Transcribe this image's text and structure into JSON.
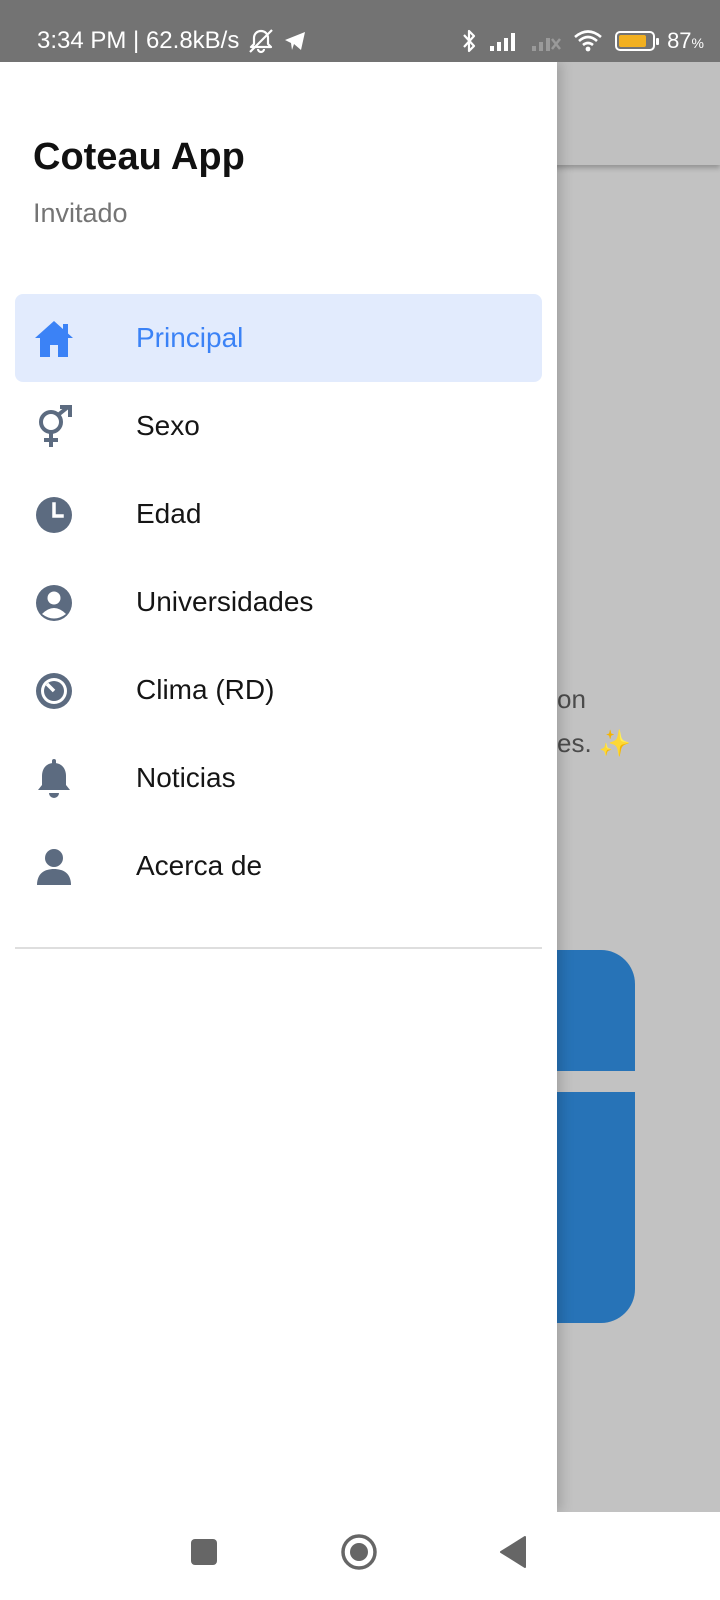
{
  "status_bar": {
    "time_speed": "3:34 PM | 62.8kB/s",
    "battery_percent": "87",
    "battery_unit": "%",
    "battery_level": 0.87,
    "battery_color": "#f2b020",
    "icons": [
      "bell-off-icon",
      "telegram-icon",
      "bluetooth-icon",
      "signal-icon",
      "signal-off-icon",
      "wifi-icon",
      "battery-icon"
    ]
  },
  "drawer": {
    "title": "Coteau App",
    "subtitle": "Invitado",
    "items": [
      {
        "label": "Principal",
        "icon": "home-icon",
        "active": true
      },
      {
        "label": "Sexo",
        "icon": "gender-icon",
        "active": false
      },
      {
        "label": "Edad",
        "icon": "clock-icon",
        "active": false
      },
      {
        "label": "Universidades",
        "icon": "user-circle-icon",
        "active": false
      },
      {
        "label": "Clima (RD)",
        "icon": "timer-icon",
        "active": false
      },
      {
        "label": "Noticias",
        "icon": "bell-icon",
        "active": false
      },
      {
        "label": "Acerca de",
        "icon": "person-icon",
        "active": false
      }
    ]
  },
  "background": {
    "text_line1": "on",
    "text_line2": "es. ✨"
  },
  "colors": {
    "accent": "#3b82f6",
    "active_bg": "#e2ebfd",
    "icon": "#5c6b80",
    "card": "#2773b7"
  },
  "nav_bar": {
    "icons": [
      "square-icon",
      "circle-icon",
      "back-triangle-icon"
    ]
  }
}
